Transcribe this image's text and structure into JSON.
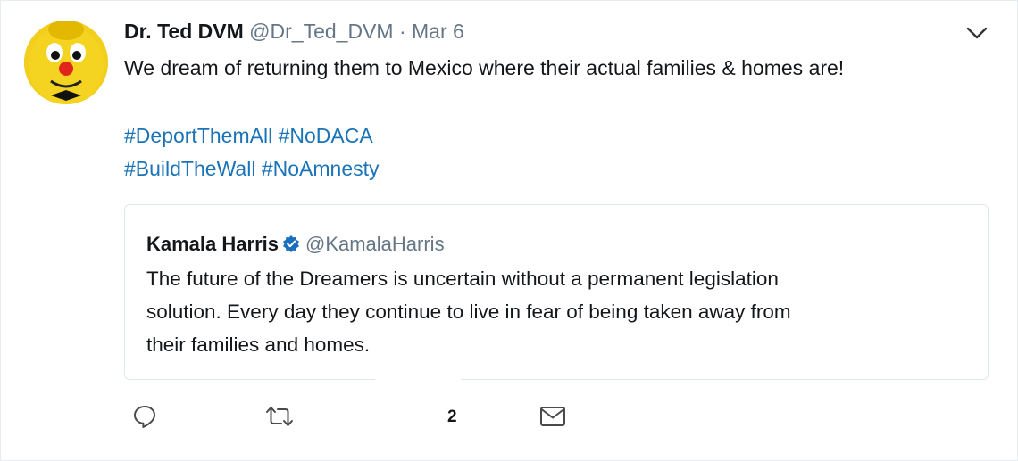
{
  "author": {
    "display_name": "Dr. Ted DVM",
    "handle": "@Dr_Ted_DVM",
    "separator": "·",
    "date": "Mar 6",
    "avatar_icon": "yellow-mascot-avatar"
  },
  "tweet": {
    "text": "We dream of returning them to Mexico where their actual families & homes are!",
    "hashtags_line1": [
      "#DeportThemAll",
      "#NoDACA"
    ],
    "hashtags_line2": [
      "#BuildTheWall",
      "#NoAmnesty"
    ]
  },
  "quoted": {
    "display_name": "Kamala Harris",
    "verified_icon": "verified-badge-icon",
    "handle": "@KamalaHarris",
    "text_line1": "The future of the Dreamers is uncertain without a permanent legislation",
    "text_line2": "solution. Every day they continue to live in fear of being taken away from",
    "text_line3": "their families and homes."
  },
  "actions": {
    "reply_icon": "reply-icon",
    "retweet_icon": "retweet-icon",
    "like_count": "2",
    "dm_icon": "envelope-icon"
  },
  "colors": {
    "link": "#1b73b8",
    "muted": "#657786",
    "verified": "#1da1f2"
  }
}
